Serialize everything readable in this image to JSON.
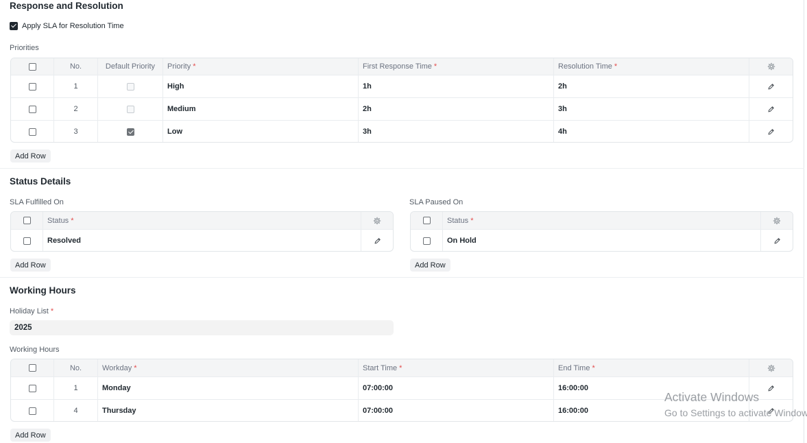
{
  "response_section": {
    "title": "Response and Resolution",
    "apply_sla_label": "Apply SLA for Resolution Time",
    "apply_sla_checked": true,
    "priorities_label": "Priorities",
    "headers": {
      "no": "No.",
      "default_priority": "Default Priority",
      "priority": "Priority",
      "first_response": "First Response Time",
      "resolution": "Resolution Time"
    },
    "rows": [
      {
        "no": "1",
        "default": false,
        "priority": "High",
        "first_response": "1h",
        "resolution": "2h"
      },
      {
        "no": "2",
        "default": false,
        "priority": "Medium",
        "first_response": "2h",
        "resolution": "3h"
      },
      {
        "no": "3",
        "default": true,
        "priority": "Low",
        "first_response": "3h",
        "resolution": "4h"
      }
    ],
    "add_row": "Add Row"
  },
  "status_section": {
    "title": "Status Details",
    "fulfilled": {
      "label": "SLA Fulfilled On",
      "header": "Status",
      "rows": [
        {
          "status": "Resolved"
        }
      ],
      "add_row": "Add Row"
    },
    "paused": {
      "label": "SLA Paused On",
      "header": "Status",
      "rows": [
        {
          "status": "On Hold"
        }
      ],
      "add_row": "Add Row"
    }
  },
  "working_section": {
    "title": "Working Hours",
    "holiday_label": "Holiday List",
    "holiday_value": "2025",
    "table_label": "Working Hours",
    "headers": {
      "no": "No.",
      "workday": "Workday",
      "start": "Start Time",
      "end": "End Time"
    },
    "rows": [
      {
        "no": "1",
        "workday": "Monday",
        "start": "07:00:00",
        "end": "16:00:00"
      },
      {
        "no": "4",
        "workday": "Thursday",
        "start": "07:00:00",
        "end": "16:00:00"
      }
    ],
    "add_row": "Add Row"
  },
  "required_mark": "*",
  "watermark": {
    "line1": "Activate Windows",
    "line2": "Go to Settings to activate Windows."
  },
  "icons": {
    "settings": "gear-icon",
    "edit": "pencil-icon",
    "checkbox": "checkbox"
  },
  "colors": {
    "required": "#e24c4c",
    "header_bg": "#f4f5f6",
    "text": "#1f272e"
  }
}
